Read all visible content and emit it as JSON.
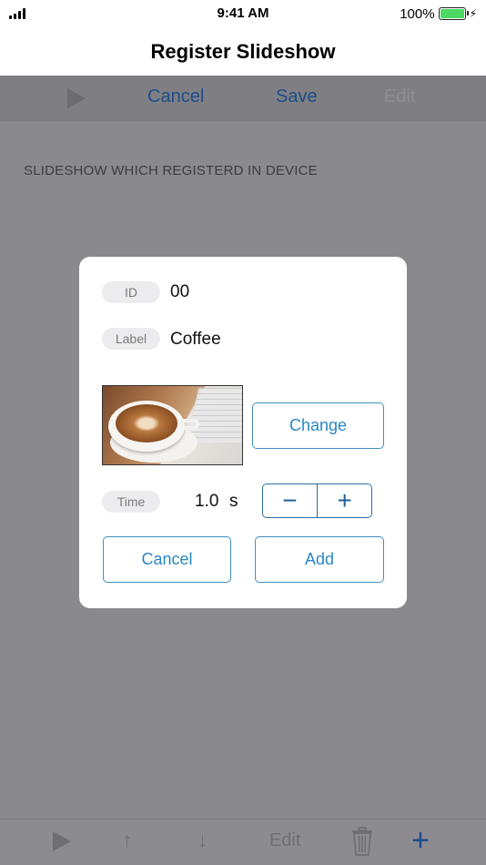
{
  "status_bar": {
    "time": "9:41 AM",
    "battery_percent": "100%",
    "battery_level": 1.0,
    "icons": [
      "signal-icon",
      "battery-icon",
      "charging-bolt-icon"
    ]
  },
  "nav": {
    "title": "Register Slideshow"
  },
  "toolbar": {
    "cancel_label": "Cancel",
    "save_label": "Save",
    "edit_label": "Edit"
  },
  "section": {
    "header": "SLIDESHOW WHICH REGISTERD IN DEVICE"
  },
  "dialog": {
    "id_tag": "ID",
    "id_value": "00",
    "label_tag": "Label",
    "label_value": "Coffee",
    "change_label": "Change",
    "time_tag": "Time",
    "time_value": "1.0",
    "time_unit": "s",
    "decrement_symbol": "−",
    "increment_symbol": "+",
    "cancel_label": "Cancel",
    "add_label": "Add"
  },
  "bottom_bar": {
    "edit_label": "Edit",
    "up_symbol": "↑",
    "down_symbol": "↓",
    "add_symbol": "+"
  },
  "colors": {
    "accent": "#2a86c4",
    "toolbar_accent": "#1e4c8a",
    "overlay": "#8a8a8e",
    "battery": "#4cd964"
  }
}
